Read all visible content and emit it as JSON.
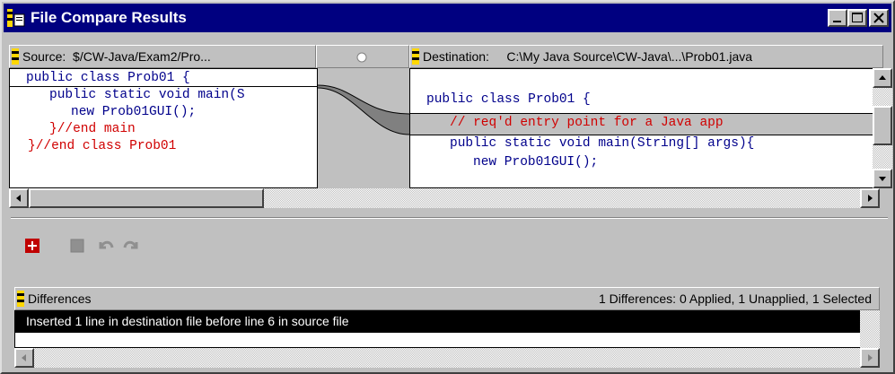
{
  "window": {
    "title": "File Compare Results",
    "controls": [
      "minimize-icon",
      "maximize-icon",
      "close-icon"
    ]
  },
  "source": {
    "label": "Source:",
    "path": "$/CW-Java/Exam2/Pro...",
    "lines": [
      {
        "indent": "",
        "code": "public class Prob01 {"
      },
      {
        "indent": "   ",
        "code": "public static void main(S"
      },
      {
        "indent": "     ",
        "code": "new Prob01GUI();"
      },
      {
        "indent": "   ",
        "code": "}//end main"
      },
      {
        "indent": "",
        "code": "}//end class Prob01"
      }
    ]
  },
  "destination": {
    "label": "Destination:",
    "path": "C:\\My Java Source\\CW-Java\\...\\Prob01.java",
    "lines": [
      {
        "indent": "",
        "code": "public class Prob01 {"
      },
      {
        "indent": "   ",
        "code": "// req'd entry point for a Java app"
      },
      {
        "indent": "   ",
        "code": "public static void main(String[] args){"
      },
      {
        "indent": "     ",
        "code": "new Prob01GUI();"
      }
    ]
  },
  "toolbar": {
    "items": [
      "apply-diff-icon",
      "stop-icon",
      "undo-icon",
      "redo-icon"
    ]
  },
  "differences": {
    "label": "Differences",
    "summary": "1 Differences:  0 Applied, 1 Unapplied, 1 Selected",
    "rows": [
      "Inserted 1 line in destination file before line 6 in source file"
    ]
  },
  "colors": {
    "titlebar": "#000080",
    "keyword": "#00008b",
    "comment": "#d00000",
    "selection": "#000000"
  }
}
